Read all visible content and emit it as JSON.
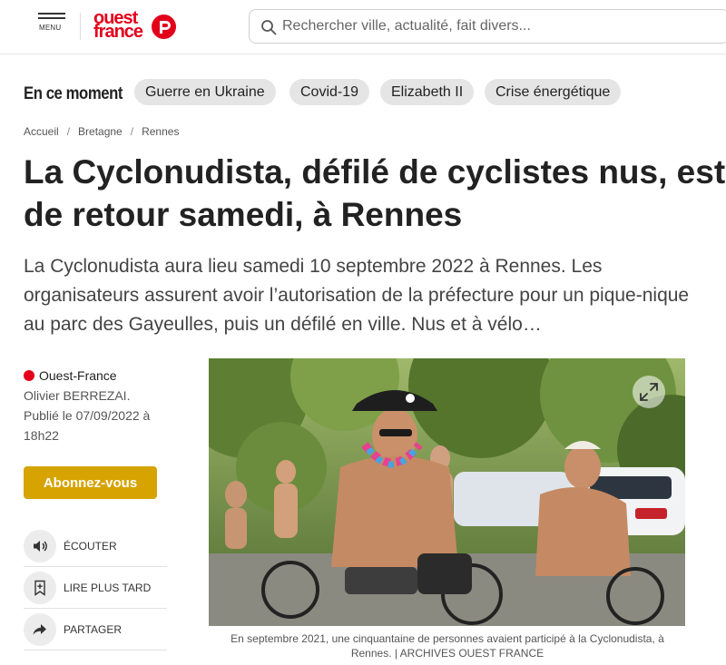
{
  "header": {
    "menu_label": "MENU",
    "logo_line1": "ouest",
    "logo_line2": "france",
    "search_placeholder": "Rechercher ville, actualité, fait divers..."
  },
  "trending": {
    "label": "En ce moment",
    "chips": [
      "Guerre en Ukraine",
      "Covid-19",
      "Elizabeth II",
      "Crise énergétique"
    ]
  },
  "breadcrumb": [
    "Accueil",
    "Bretagne",
    "Rennes"
  ],
  "article": {
    "title": "La Cyclonudista, défilé de cyclistes nus, est de retour samedi, à Rennes",
    "lead": "La Cyclonudista aura lieu samedi 10 septembre 2022 à Rennes. Les organisateurs assurent avoir l’autorisation de la préfecture pour un pique-nique au parc des Gayeulles, puis un défilé en ville. Nus et à vélo…",
    "source": "Ouest-France",
    "author": "Olivier BERREZAI.",
    "published": "Publié le 07/09/2022 à 18h22",
    "subscribe_label": "Abonnez-vous",
    "actions": {
      "listen": "ÉCOUTER",
      "read_later": "LIRE PLUS TARD",
      "share": "PARTAGER"
    },
    "caption": "En septembre 2021, une cinquantaine de personnes avaient participé à la Cyclonudista, à Rennes. | ARCHIVES OUEST FRANCE"
  },
  "colors": {
    "brand_red": "#e3001b",
    "subscribe_gold": "#d6a300",
    "chip_bg": "#e5e5e5"
  },
  "icons": [
    "menu-icon",
    "search-icon",
    "speaker-icon",
    "bookmark-icon",
    "share-icon",
    "expand-icon"
  ]
}
